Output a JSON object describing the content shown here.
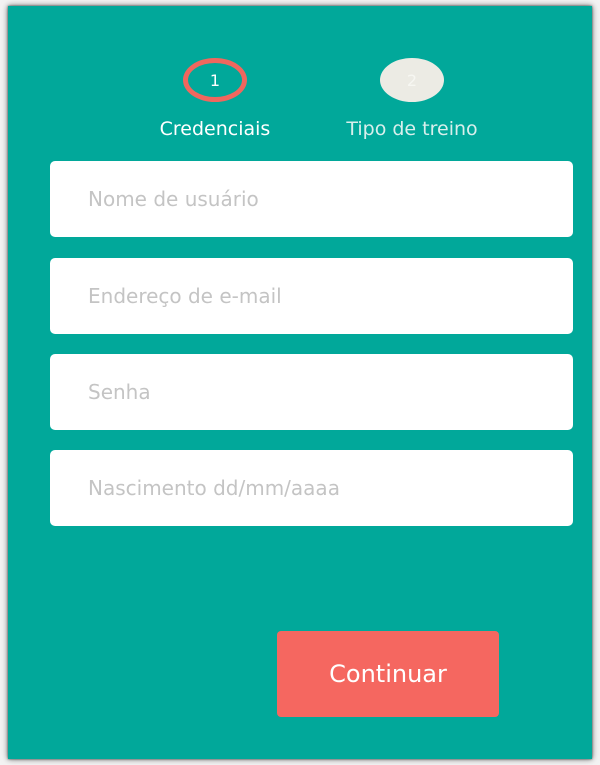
{
  "stepper": {
    "steps": [
      {
        "number": "1",
        "label": "Credenciais",
        "state": "active"
      },
      {
        "number": "2",
        "label": "Tipo de treino",
        "state": "inactive"
      }
    ]
  },
  "form": {
    "username_placeholder": "Nome de usuário",
    "email_placeholder": "Endereço de e-mail",
    "password_placeholder": "Senha",
    "birthdate_placeholder": "Nascimento dd/mm/aaaa"
  },
  "actions": {
    "continue_label": "Continuar"
  },
  "colors": {
    "background": "#01a89a",
    "accent": "#f56760",
    "active_step_ring": "#f0675e",
    "inactive_step": "#ecebe4"
  }
}
